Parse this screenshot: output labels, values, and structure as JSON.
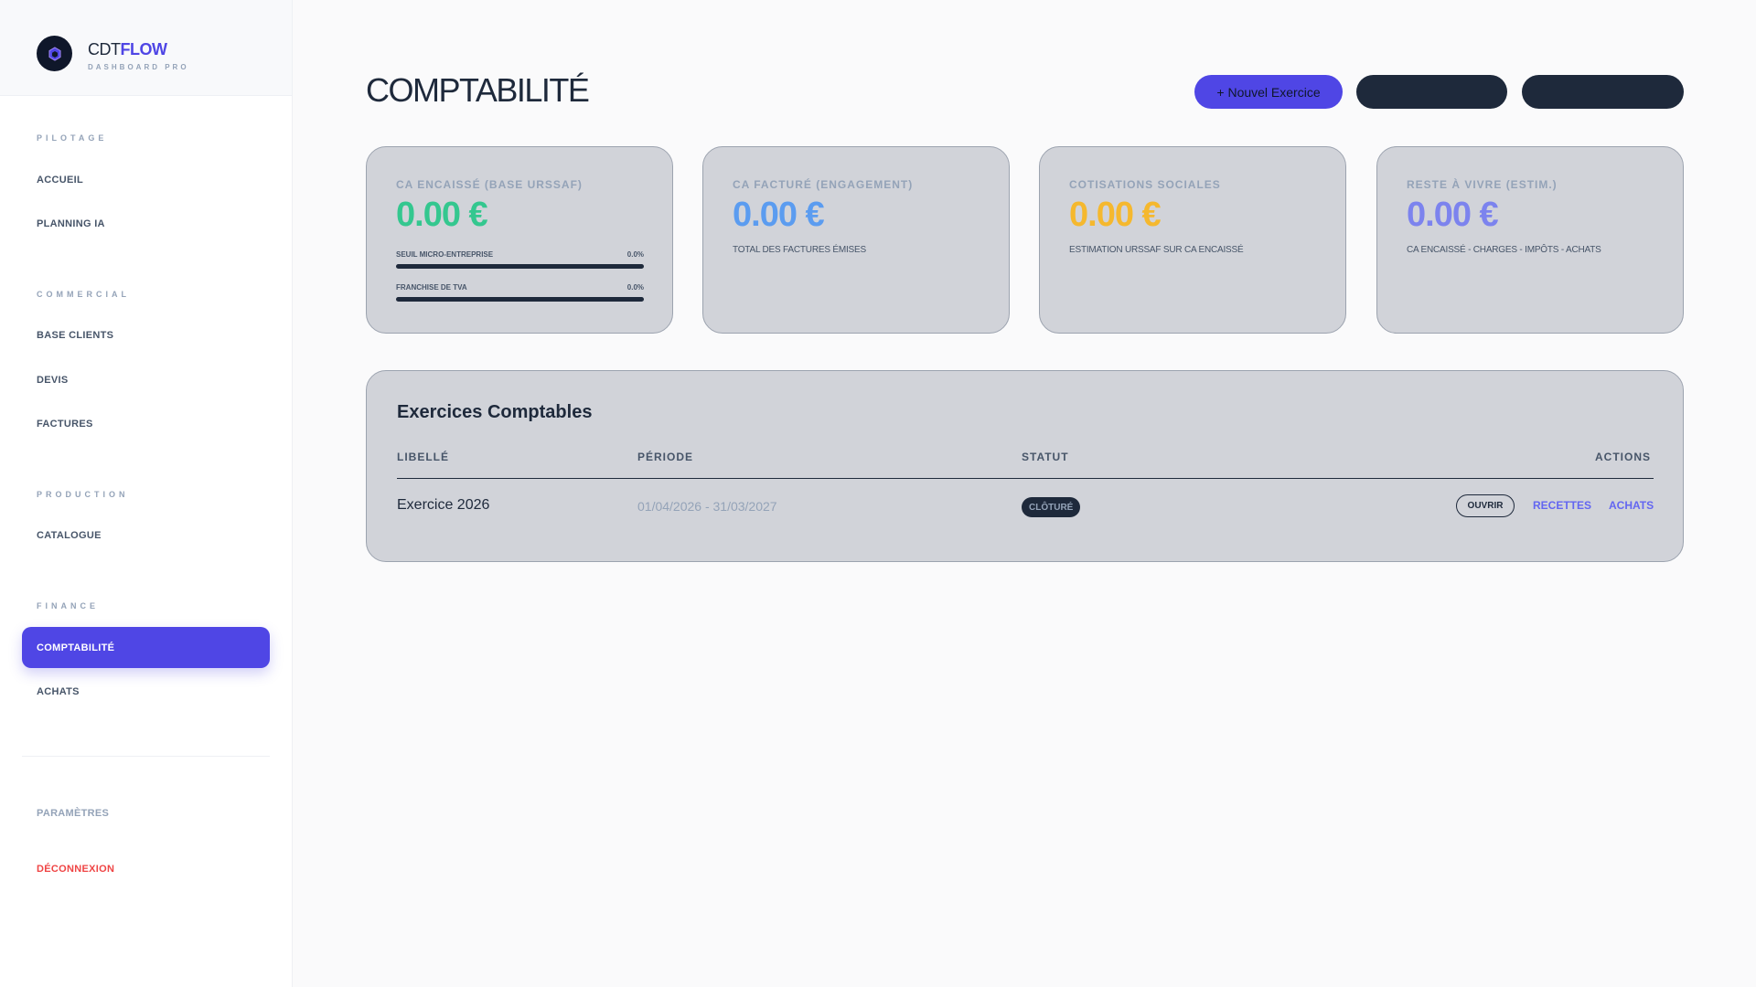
{
  "brand": {
    "name_prefix": "CDT",
    "name_suffix": "FLOW",
    "subtitle": "DASHBOARD PRO"
  },
  "sidebar": {
    "sections": [
      {
        "title": "PILOTAGE",
        "items": [
          "ACCUEIL",
          "PLANNING IA"
        ]
      },
      {
        "title": "COMMERCIAL",
        "items": [
          "BASE CLIENTS",
          "DEVIS",
          "FACTURES"
        ]
      },
      {
        "title": "PRODUCTION",
        "items": [
          "CATALOGUE"
        ]
      },
      {
        "title": "FINANCE",
        "items": [
          "COMPTABILITÉ",
          "ACHATS"
        ]
      }
    ],
    "active_item": "COMPTABILITÉ",
    "settings": "PARAMÈTRES",
    "logout": "DÉCONNEXION"
  },
  "header": {
    "title": "COMPTABILITÉ",
    "new_exercise_button": "+ Nouvel Exercice",
    "button_2": "",
    "button_3": ""
  },
  "cards": [
    {
      "label": "CA ENCAISSÉ (BASE URSSAF)",
      "value": "0.00 €",
      "color": "#34c78f",
      "gauges": [
        {
          "label": "SEUIL MICRO-ENTREPRISE",
          "value_text": "0.0%",
          "fraction": 0.0
        },
        {
          "label": "FRANCHISE DE TVA",
          "value_text": "0.0%",
          "fraction": 0.0
        }
      ]
    },
    {
      "label": "CA FACTURÉ (ENGAGEMENT)",
      "value": "0.00 €",
      "color": "#5b9cf0",
      "sub": "TOTAL DES FACTURES ÉMISES"
    },
    {
      "label": "COTISATIONS SOCIALES",
      "value": "0.00 €",
      "color": "#f5b82e",
      "sub": "ESTIMATION URSSAF SUR CA ENCAISSÉ"
    },
    {
      "label": "RESTE À VIVRE (ESTIM.)",
      "value": "0.00 €",
      "color": "#7c83ee",
      "sub": "CA ENCAISSÉ - CHARGES - IMPÔTS - ACHATS"
    }
  ],
  "exercises": {
    "title": "Exercices Comptables",
    "columns": {
      "label": "LIBELLÉ",
      "period": "PÉRIODE",
      "status": "STATUT",
      "actions": "ACTIONS"
    },
    "rows": [
      {
        "label": "Exercice 2026",
        "period": "01/04/2026 - 31/03/2027",
        "status": "CLÔTURÉ",
        "open": "OUVRIR",
        "receipts": "RECETTES",
        "purchases": "ACHATS"
      }
    ]
  },
  "colors": {
    "accent": "#4f46e5",
    "dark": "#1e293b",
    "danger": "#ef4444"
  }
}
